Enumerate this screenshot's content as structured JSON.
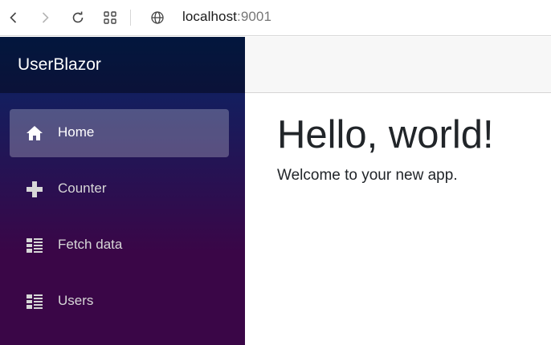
{
  "browser": {
    "url_host": "localhost",
    "url_port": ":9001",
    "icons": [
      "back-icon",
      "forward-icon",
      "reload-icon",
      "apps-icon",
      "globe-icon"
    ]
  },
  "sidebar": {
    "brand": "UserBlazor",
    "items": [
      {
        "label": "Home",
        "icon": "home-icon",
        "active": true
      },
      {
        "label": "Counter",
        "icon": "plus-icon",
        "active": false
      },
      {
        "label": "Fetch data",
        "icon": "list-icon",
        "active": false
      },
      {
        "label": "Users",
        "icon": "list-icon",
        "active": false
      }
    ]
  },
  "main": {
    "heading": "Hello, world!",
    "welcome": "Welcome to your new app."
  },
  "colors": {
    "sidebar_top": "#052767",
    "sidebar_bottom": "#3a0647",
    "top_row": "#f7f7f7"
  }
}
